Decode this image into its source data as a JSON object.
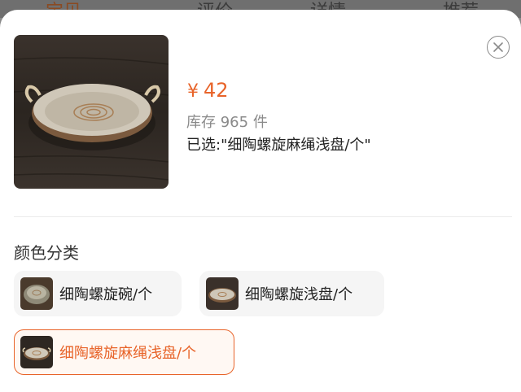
{
  "tabs": [
    {
      "label": "宝贝"
    },
    {
      "label": "评价"
    },
    {
      "label": "详情"
    },
    {
      "label": "推荐"
    }
  ],
  "product": {
    "currency": "¥",
    "price": "42",
    "stock_label": "库存",
    "stock_count": "965",
    "stock_unit": "件",
    "selected_text": "已选:\"细陶螺旋麻绳浅盘/个\""
  },
  "variants": {
    "section_title": "颜色分类",
    "options": [
      {
        "label": "细陶螺旋碗/个",
        "selected": false
      },
      {
        "label": "细陶螺旋浅盘/个",
        "selected": false
      },
      {
        "label": "细陶螺旋麻绳浅盘/个",
        "selected": true
      }
    ]
  },
  "colors": {
    "accent": "#e8642a",
    "selected_bg": "#fff8f3",
    "chip_bg": "#f5f5f5"
  },
  "icons": {
    "close": "close-icon"
  }
}
